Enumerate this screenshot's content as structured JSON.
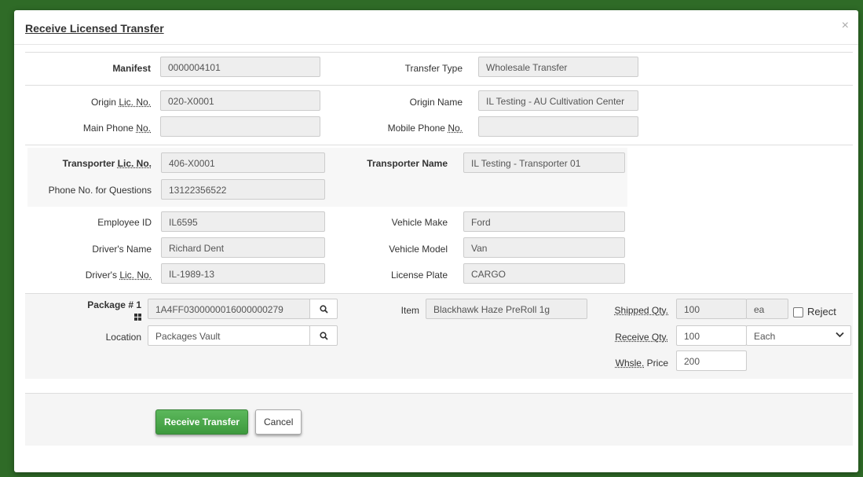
{
  "modal": {
    "title": "Receive Licensed Transfer",
    "close_glyph": "×"
  },
  "manifest": {
    "label": "Manifest",
    "value": "0000004101"
  },
  "transfer_type": {
    "label": "Transfer Type",
    "value": "Wholesale Transfer"
  },
  "origin": {
    "lic_label_pre": "Origin ",
    "lic_label_abbr": "Lic. No.",
    "lic_value": "020-X0001",
    "name_label": "Origin Name",
    "name_value": "IL Testing - AU Cultivation Center",
    "main_phone_label_pre": "Main Phone ",
    "main_phone_label_abbr": "No.",
    "main_phone_value": "",
    "mobile_phone_label_pre": "Mobile Phone ",
    "mobile_phone_label_abbr": "No.",
    "mobile_phone_value": ""
  },
  "transporter": {
    "lic_label_pre": "Transporter ",
    "lic_label_abbr": "Lic. No.",
    "lic_value": "406-X0001",
    "name_label": "Transporter Name",
    "name_value": "IL Testing - Transporter 01",
    "phone_label": "Phone No. for Questions",
    "phone_value": "13122356522"
  },
  "driver": {
    "employee_label": "Employee ID",
    "employee_value": "IL6595",
    "name_label": "Driver's Name",
    "name_value": "Richard Dent",
    "lic_label_pre": "Driver's ",
    "lic_label_abbr": "Lic. No.",
    "lic_value": "IL-1989-13"
  },
  "vehicle": {
    "make_label": "Vehicle Make",
    "make_value": "Ford",
    "model_label": "Vehicle Model",
    "model_value": "Van",
    "plate_label": "License Plate",
    "plate_value": "CARGO"
  },
  "package": {
    "label": "Package # 1",
    "value": "1A4FF0300000016000000279",
    "location_label": "Location",
    "location_value": "Packages Vault",
    "item_label": "Item",
    "item_value": "Blackhawk Haze PreRoll 1g",
    "shipped_label_abbr": "Shipped Qty.",
    "shipped_value": "100",
    "shipped_unit": "ea",
    "reject_label": "Reject",
    "receive_label_abbr": "Receive Qty.",
    "receive_value": "100",
    "receive_unit": "Each",
    "price_label_abbr": "Whsle.",
    "price_label_post": " Price",
    "price_value": "200"
  },
  "footer": {
    "receive_button": "Receive Transfer",
    "cancel_button": "Cancel"
  }
}
